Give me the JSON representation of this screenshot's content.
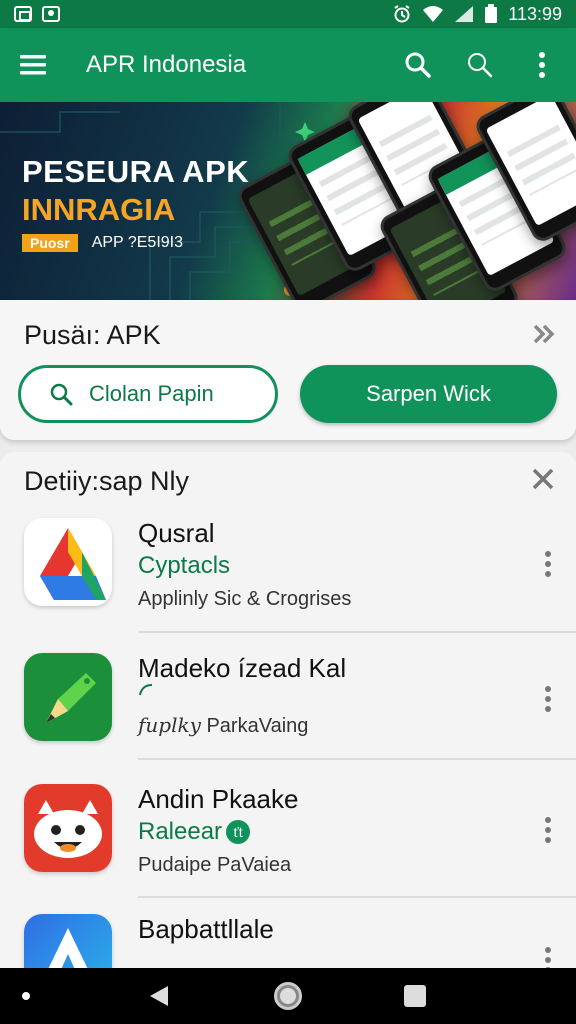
{
  "status_bar": {
    "time": "113:99",
    "icons": [
      "screenshot-icon",
      "camera-icon",
      "alarm-icon",
      "wifi-icon",
      "signal-icon",
      "battery-icon"
    ]
  },
  "app_bar": {
    "title": "APR Indonesia",
    "icons": [
      "menu-icon",
      "search-icon",
      "search-icon",
      "more-vert-icon"
    ]
  },
  "banner": {
    "line1": "PESEURA APK",
    "line2": "INNRAGIA",
    "badge": "Puosr",
    "subtitle": "APP ?E5I9I3"
  },
  "section1": {
    "title": "Pusäı: APK",
    "outline_button": "Clolan Papin",
    "filled_button": "Sarpen Wick"
  },
  "section2": {
    "title": "Detiiy:sap Nly",
    "apps": [
      {
        "name": "Qusral",
        "category": "Cyptacls",
        "description": "Applinly Sic & Crogrises"
      },
      {
        "name": "Madeko ízead Kal",
        "category": "",
        "description": "ParkaVaing",
        "desc_prefix": "fuplky"
      },
      {
        "name": "Andin Pkaake",
        "category": "Raleear",
        "badge": "ťt",
        "description": "Pudaipe PaVaiea"
      },
      {
        "name": "Bapbattllale",
        "category": "",
        "description": ""
      }
    ]
  },
  "colors": {
    "primary": "#10935a",
    "primary_dark": "#0d7a45",
    "accent_orange": "#f2a21a"
  }
}
